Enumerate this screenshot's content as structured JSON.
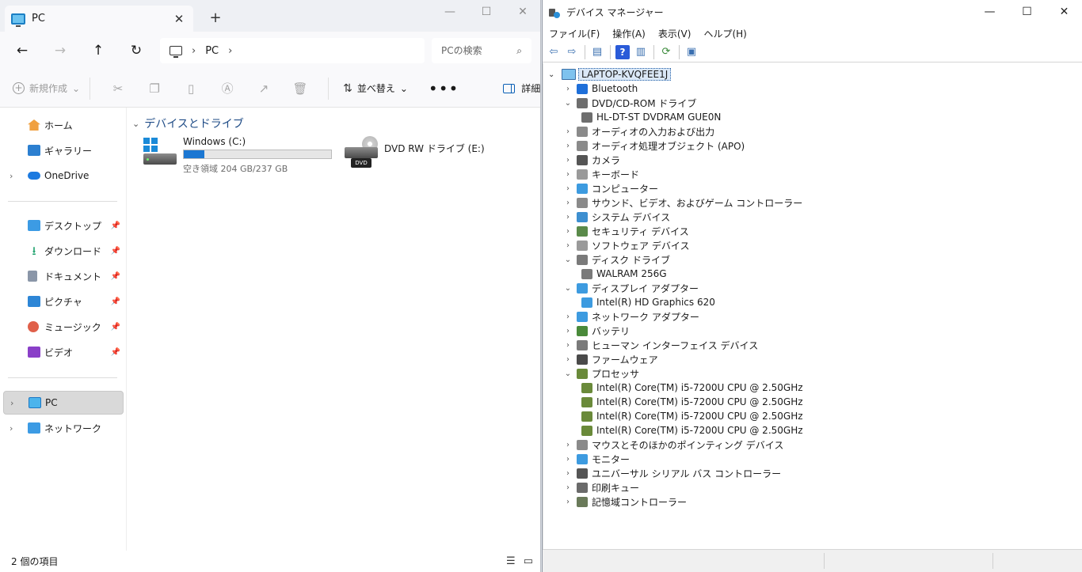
{
  "explorer": {
    "tab": {
      "title": "PC",
      "close": "✕"
    },
    "new_tab": "+",
    "window_controls": [
      "—",
      "☐",
      "✕"
    ],
    "nav": {
      "back": "←",
      "forward": "→",
      "up": "↑",
      "refresh": "↻"
    },
    "address": {
      "crumb": "PC",
      "sep1": "›",
      "sep2": "›"
    },
    "search": {
      "placeholder": "PCの検索",
      "icon": "search-icon"
    },
    "commands": {
      "new": "新規作成",
      "new_caret": "⌄",
      "sort": "並べ替え",
      "sort_caret": "⌄",
      "more": "•••",
      "details": "詳細",
      "icons": [
        "cut-icon",
        "copy-icon",
        "paste-icon",
        "rename-icon",
        "share-icon",
        "delete-icon"
      ]
    },
    "sidebar": {
      "home": "ホーム",
      "gallery": "ギャラリー",
      "onedrive": "OneDrive",
      "desktop": "デスクトップ",
      "downloads": "ダウンロード",
      "documents": "ドキュメント",
      "pictures": "ピクチャ",
      "music": "ミュージック",
      "videos": "ビデオ",
      "pc": "PC",
      "network": "ネットワーク",
      "chevron": "›",
      "pin": "📌"
    },
    "content": {
      "group_chevron": "⌄",
      "group_title": "デバイスとドライブ",
      "drive_c": {
        "name": "Windows (C:)",
        "free": "空き領域 204 GB/237 GB",
        "used_fraction": 0.139
      },
      "drive_e": {
        "name": "DVD RW ドライブ (E:)",
        "tag": "DVD"
      }
    },
    "status": {
      "count": "2 個の項目",
      "view_list": "☰",
      "view_tiles": "▭"
    }
  },
  "device_manager": {
    "title": "デバイス マネージャー",
    "window_controls": [
      "—",
      "☐",
      "✕"
    ],
    "menu": [
      "ファイル(F)",
      "操作(A)",
      "表示(V)",
      "ヘルプ(H)"
    ],
    "toolbar": {
      "back": "⇦",
      "forward": "⇨",
      "props": "▤",
      "help": "?",
      "view": "▥",
      "scan": "⟳",
      "monitor": "▣"
    },
    "root": {
      "label": "LAPTOP-KVQFEE1J",
      "chevron": "⌄"
    },
    "tree": [
      {
        "level": 1,
        "exp": "›",
        "label": "Bluetooth",
        "icon": "bluetooth-icon",
        "color": "#1e6fd9"
      },
      {
        "level": 1,
        "exp": "⌄",
        "label": "DVD/CD-ROM ドライブ",
        "icon": "optical-drive-icon",
        "color": "#6e6e6e"
      },
      {
        "level": 2,
        "exp": "",
        "label": "HL-DT-ST DVDRAM GUE0N",
        "icon": "optical-drive-icon",
        "color": "#6e6e6e"
      },
      {
        "level": 1,
        "exp": "›",
        "label": "オーディオの入力および出力",
        "icon": "speaker-icon",
        "color": "#8a8a8a"
      },
      {
        "level": 1,
        "exp": "›",
        "label": "オーディオ処理オブジェクト (APO)",
        "icon": "speaker-icon",
        "color": "#8a8a8a"
      },
      {
        "level": 1,
        "exp": "›",
        "label": "カメラ",
        "icon": "camera-icon",
        "color": "#555555"
      },
      {
        "level": 1,
        "exp": "›",
        "label": "キーボード",
        "icon": "keyboard-icon",
        "color": "#9a9a9a"
      },
      {
        "level": 1,
        "exp": "›",
        "label": "コンピューター",
        "icon": "computer-icon",
        "color": "#3d9be0"
      },
      {
        "level": 1,
        "exp": "›",
        "label": "サウンド、ビデオ、およびゲーム コントローラー",
        "icon": "speaker-icon",
        "color": "#8a8a8a"
      },
      {
        "level": 1,
        "exp": "›",
        "label": "システム デバイス",
        "icon": "system-device-icon",
        "color": "#3d8fd0"
      },
      {
        "level": 1,
        "exp": "›",
        "label": "セキュリティ デバイス",
        "icon": "security-device-icon",
        "color": "#5a8a4a"
      },
      {
        "level": 1,
        "exp": "›",
        "label": "ソフトウェア デバイス",
        "icon": "software-device-icon",
        "color": "#9a9a9a"
      },
      {
        "level": 1,
        "exp": "⌄",
        "label": "ディスク ドライブ",
        "icon": "disk-drive-icon",
        "color": "#7a7a7a"
      },
      {
        "level": 2,
        "exp": "",
        "label": "WALRAM 256G",
        "icon": "disk-drive-icon",
        "color": "#7a7a7a"
      },
      {
        "level": 1,
        "exp": "⌄",
        "label": "ディスプレイ アダプター",
        "icon": "display-adapter-icon",
        "color": "#3d9be0"
      },
      {
        "level": 2,
        "exp": "",
        "label": "Intel(R) HD Graphics 620",
        "icon": "display-adapter-icon",
        "color": "#3d9be0"
      },
      {
        "level": 1,
        "exp": "›",
        "label": "ネットワーク アダプター",
        "icon": "network-adapter-icon",
        "color": "#3d9be0"
      },
      {
        "level": 1,
        "exp": "›",
        "label": "バッテリ",
        "icon": "battery-icon",
        "color": "#4a8a3a"
      },
      {
        "level": 1,
        "exp": "›",
        "label": "ヒューマン インターフェイス デバイス",
        "icon": "hid-icon",
        "color": "#7a7a7a"
      },
      {
        "level": 1,
        "exp": "›",
        "label": "ファームウェア",
        "icon": "firmware-icon",
        "color": "#4a4a4a"
      },
      {
        "level": 1,
        "exp": "⌄",
        "label": "プロセッサ",
        "icon": "processor-icon",
        "color": "#6a8a3a"
      },
      {
        "level": 2,
        "exp": "",
        "label": "Intel(R) Core(TM) i5-7200U CPU @ 2.50GHz",
        "icon": "processor-icon",
        "color": "#6a8a3a"
      },
      {
        "level": 2,
        "exp": "",
        "label": "Intel(R) Core(TM) i5-7200U CPU @ 2.50GHz",
        "icon": "processor-icon",
        "color": "#6a8a3a"
      },
      {
        "level": 2,
        "exp": "",
        "label": "Intel(R) Core(TM) i5-7200U CPU @ 2.50GHz",
        "icon": "processor-icon",
        "color": "#6a8a3a"
      },
      {
        "level": 2,
        "exp": "",
        "label": "Intel(R) Core(TM) i5-7200U CPU @ 2.50GHz",
        "icon": "processor-icon",
        "color": "#6a8a3a"
      },
      {
        "level": 1,
        "exp": "›",
        "label": "マウスとそのほかのポインティング デバイス",
        "icon": "mouse-icon",
        "color": "#8a8a8a"
      },
      {
        "level": 1,
        "exp": "›",
        "label": "モニター",
        "icon": "monitor-icon",
        "color": "#3d9be0"
      },
      {
        "level": 1,
        "exp": "›",
        "label": "ユニバーサル シリアル バス コントローラー",
        "icon": "usb-icon",
        "color": "#555555"
      },
      {
        "level": 1,
        "exp": "›",
        "label": "印刷キュー",
        "icon": "printer-icon",
        "color": "#6a6a6a"
      },
      {
        "level": 1,
        "exp": "›",
        "label": "記憶域コントローラー",
        "icon": "storage-controller-icon",
        "color": "#6a7a5a"
      }
    ]
  },
  "colors": {
    "accent": "#1b77d2",
    "sidebar_selected": "#d9d9d9"
  }
}
